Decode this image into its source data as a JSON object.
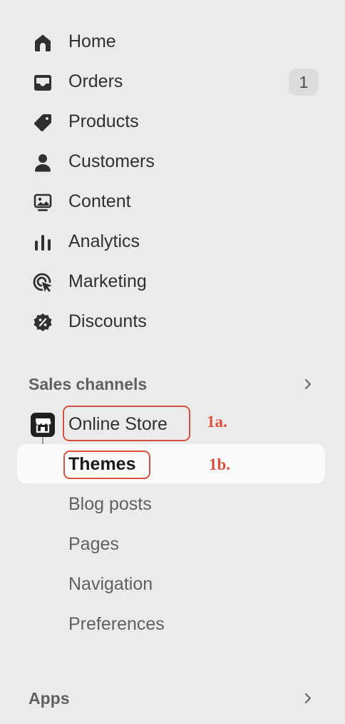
{
  "nav": {
    "items": [
      {
        "label": "Home",
        "icon": "home-icon"
      },
      {
        "label": "Orders",
        "icon": "inbox-icon",
        "badge": "1"
      },
      {
        "label": "Products",
        "icon": "tag-icon"
      },
      {
        "label": "Customers",
        "icon": "person-icon"
      },
      {
        "label": "Content",
        "icon": "image-monitor-icon"
      },
      {
        "label": "Analytics",
        "icon": "bar-chart-icon"
      },
      {
        "label": "Marketing",
        "icon": "target-cursor-icon"
      },
      {
        "label": "Discounts",
        "icon": "discount-badge-icon"
      }
    ]
  },
  "sales_channels": {
    "title": "Sales channels",
    "online_store": {
      "label": "Online Store",
      "icon": "storefront-icon"
    },
    "subitems": [
      {
        "label": "Themes",
        "active": true
      },
      {
        "label": "Blog posts"
      },
      {
        "label": "Pages"
      },
      {
        "label": "Navigation"
      },
      {
        "label": "Preferences"
      }
    ]
  },
  "apps": {
    "title": "Apps"
  },
  "annotations": {
    "online_store": "1a.",
    "themes": "1b."
  },
  "colors": {
    "background": "#ebebeb",
    "selected_row": "#fafafa",
    "badge_bg": "#dcdcdc",
    "annotation": "#d9503f"
  }
}
